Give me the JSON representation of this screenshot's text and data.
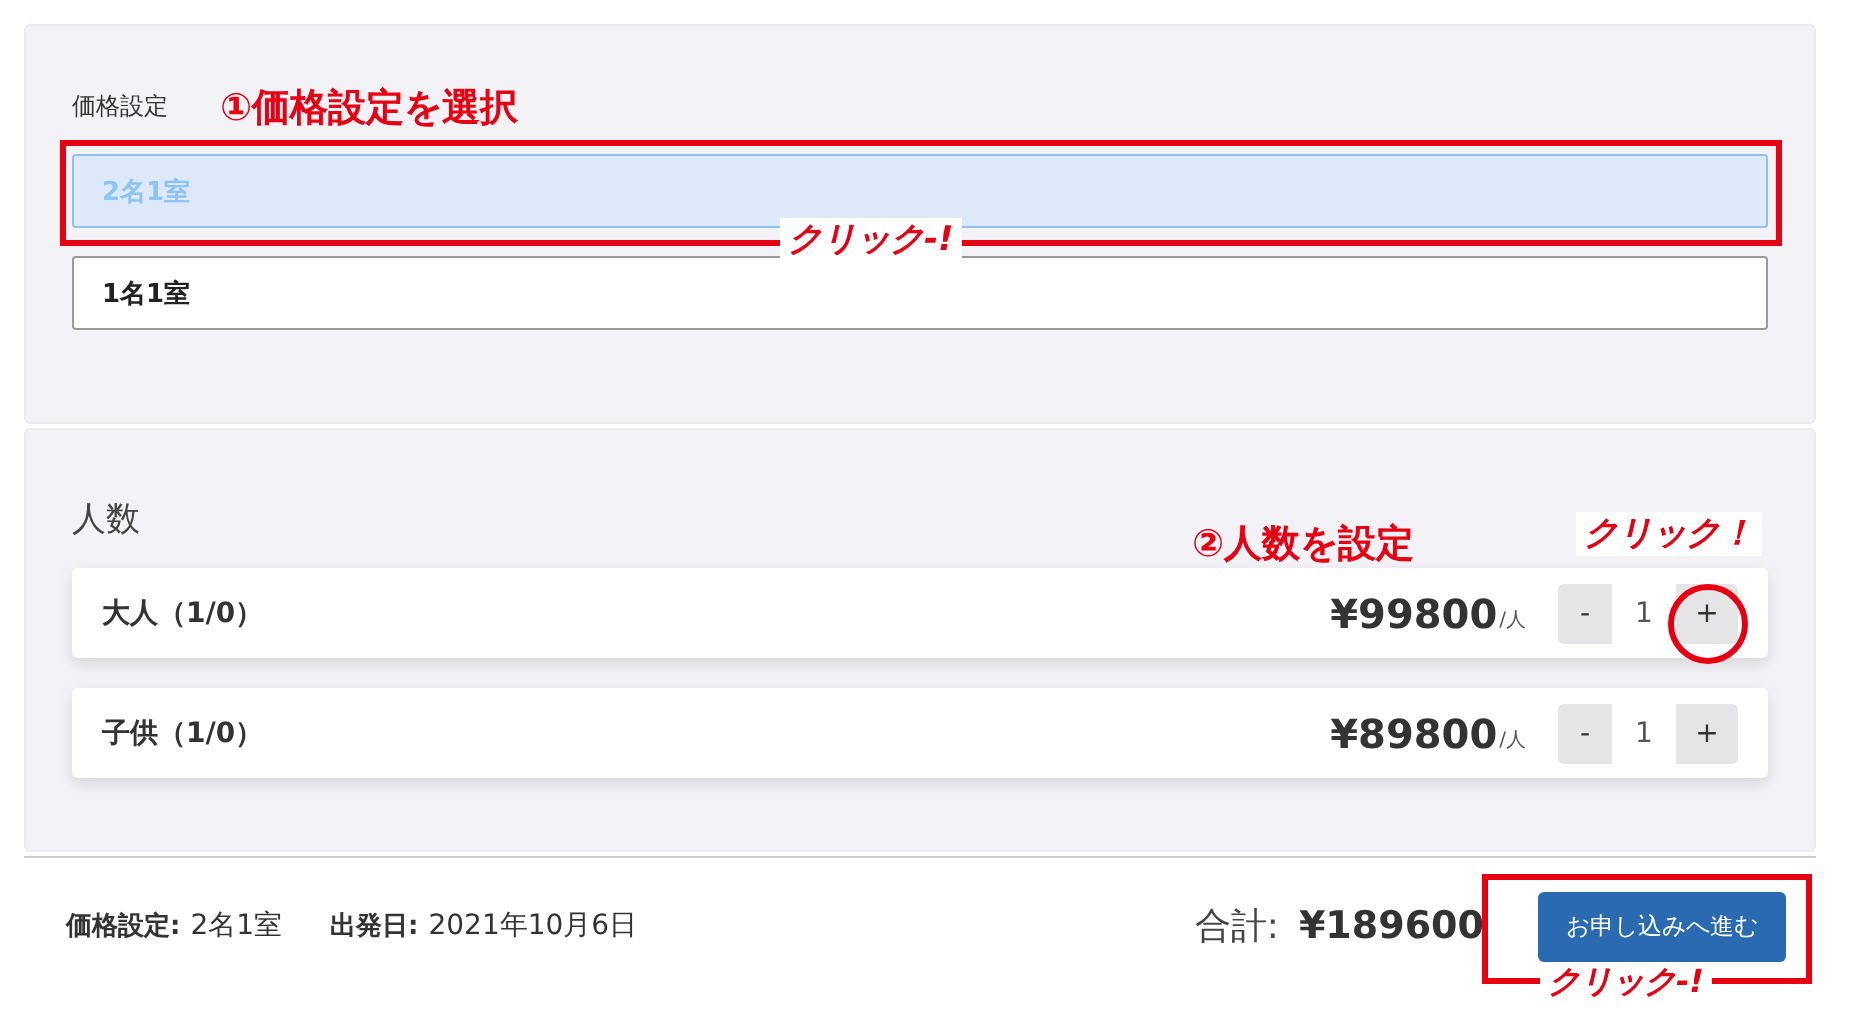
{
  "price_setting": {
    "label": "価格設定",
    "options": [
      {
        "label": "2名1室",
        "selected": true
      },
      {
        "label": "1名1室",
        "selected": false
      }
    ]
  },
  "people": {
    "title": "人数",
    "rows": [
      {
        "label": "大人（1/0）",
        "price": "¥99800",
        "unit": "/人",
        "minus": "-",
        "count": "1",
        "plus": "+"
      },
      {
        "label": "子供（1/0）",
        "price": "¥89800",
        "unit": "/人",
        "minus": "-",
        "count": "1",
        "plus": "+"
      }
    ]
  },
  "footer": {
    "summary": [
      {
        "label": "価格設定:",
        "value": "2名1室"
      },
      {
        "label": "出発日:",
        "value": "2021年10月6日"
      }
    ],
    "total_label": "合計:",
    "total": "¥189600",
    "button": "お申し込みへ進む"
  },
  "annotations": [
    {
      "kind": "step",
      "text": "①価格設定を選択"
    },
    {
      "kind": "frame"
    },
    {
      "kind": "click",
      "text": "クリック-!"
    },
    {
      "kind": "step",
      "text": "②人数を設定"
    },
    {
      "kind": "click",
      "text": "クリック！"
    },
    {
      "kind": "circle"
    },
    {
      "kind": "frame"
    },
    {
      "kind": "click",
      "text": "クリック-!"
    }
  ]
}
